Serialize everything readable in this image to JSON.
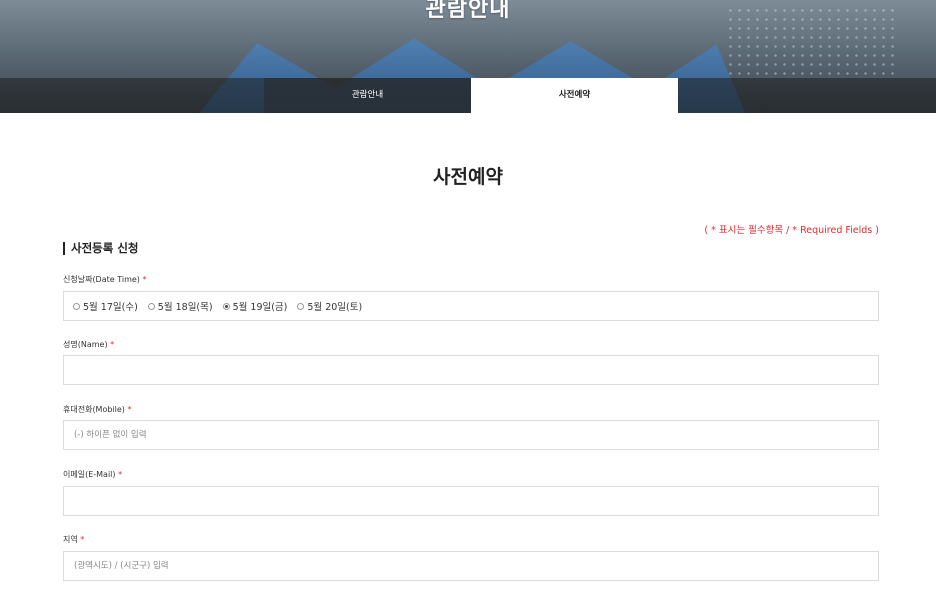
{
  "hero": {
    "title": "관람안내"
  },
  "tabs": [
    {
      "label": "관람안내",
      "active": false
    },
    {
      "label": "사전예약",
      "active": true
    }
  ],
  "page": {
    "title": "사전예약",
    "required_note": "( * 표시는 필수항목 / * Required Fields )",
    "section_title": "사전등록 신청"
  },
  "form": {
    "date": {
      "label": "신청날짜(Date Time)",
      "star": "*",
      "options": [
        {
          "label": "5월 17일(수)",
          "selected": false
        },
        {
          "label": "5월 18일(목)",
          "selected": false
        },
        {
          "label": "5월 19일(금)",
          "selected": true
        },
        {
          "label": "5월 20일(토)",
          "selected": false
        }
      ]
    },
    "name": {
      "label": "성명(Name)",
      "star": "*",
      "placeholder": "",
      "value": ""
    },
    "mobile": {
      "label": "휴대전화(Mobile)",
      "star": "*",
      "placeholder": "(-) 하이픈 없이 입력",
      "value": ""
    },
    "email": {
      "label": "이메일(E-Mail)",
      "star": "*",
      "placeholder": "",
      "value": ""
    },
    "region": {
      "label": "지역",
      "star": "*",
      "placeholder": "(광역시도) / (시군구) 입력",
      "value": ""
    }
  },
  "colors": {
    "required": "#e8282e",
    "border": "#dcdcdc",
    "tab_active_bg": "#ffffff"
  }
}
